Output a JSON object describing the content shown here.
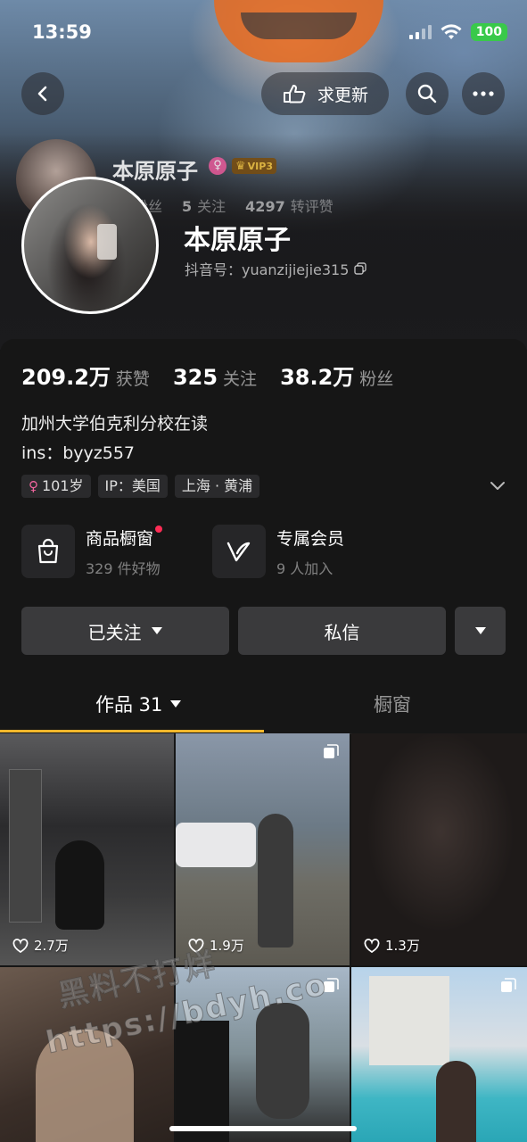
{
  "status": {
    "time": "13:59",
    "battery": "100"
  },
  "header": {
    "request_update": "求更新"
  },
  "ghost": {
    "name": "本原原子",
    "vip": "VIP3",
    "fans_label": "粉丝",
    "follow_count": "5",
    "follow_label": "关注",
    "likes_count": "4297",
    "likes_label": "转评赞"
  },
  "profile": {
    "name": "本原原子",
    "id": "抖音号：yuanzijiejie315"
  },
  "stats": [
    {
      "num": "209.2万",
      "label": "获赞"
    },
    {
      "num": "325",
      "label": "关注"
    },
    {
      "num": "38.2万",
      "label": "粉丝"
    }
  ],
  "bio": {
    "line1": "加州大学伯克利分校在读",
    "line2": "ins：byyz557"
  },
  "tags": {
    "age": "101岁",
    "ip": "IP：美国",
    "location": "上海 · 黄浦"
  },
  "features": {
    "shop_title": "商品橱窗",
    "shop_sub": "329 件好物",
    "member_title": "专属会员",
    "member_sub": "9 人加入"
  },
  "actions": {
    "followed": "已关注",
    "message": "私信"
  },
  "tabs": {
    "works": "作品 31",
    "shop": "橱窗"
  },
  "posts": [
    {
      "likes": "2.7万"
    },
    {
      "likes": "1.9万"
    },
    {
      "likes": "1.3万"
    }
  ],
  "watermark": {
    "line1": "黑料不打烊",
    "line2": "https://bdyh.co"
  },
  "colors": {
    "accent_tab": "#f4b72b",
    "notify_dot": "#fe2c55",
    "battery": "#39c94a"
  }
}
